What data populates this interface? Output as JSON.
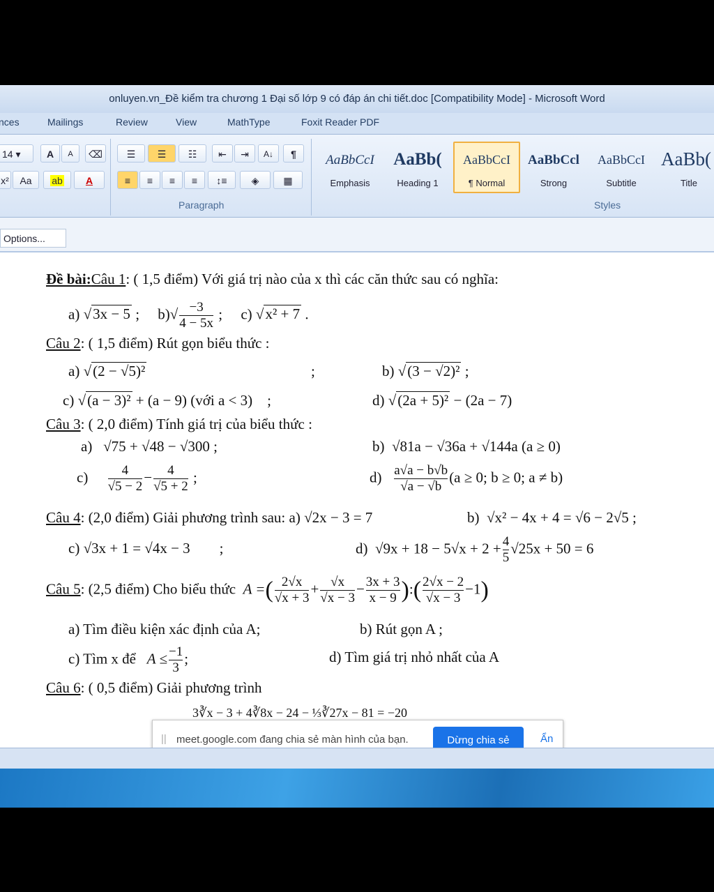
{
  "window": {
    "title": "onluyen.vn_Đề kiểm tra chương 1 Đại số lớp 9 có đáp án chi tiết.doc [Compatibility Mode] - Microsoft Word"
  },
  "ribbon": {
    "tabs": [
      "nces",
      "Mailings",
      "Review",
      "View",
      "MathType",
      "Foxit Reader PDF"
    ],
    "font_size": "14",
    "font_grow": "A",
    "font_shrink": "A",
    "change_case": "Aa",
    "font_color_glyph": "A",
    "pilcrow": "¶",
    "sort_glyph": "A↓",
    "paragraph_label": "Paragraph",
    "styles_label": "Styles",
    "styles": [
      {
        "preview": "AaBbCcI",
        "name": "Emphasis"
      },
      {
        "preview": "AaBb(",
        "name": "Heading 1"
      },
      {
        "preview": "AaBbCcI",
        "name": "¶ Normal"
      },
      {
        "preview": "AaBbCcl",
        "name": "Strong"
      },
      {
        "preview": "AaBbCcI",
        "name": "Subtitle"
      },
      {
        "preview": "AaBb(",
        "name": "Title"
      }
    ]
  },
  "options_button": "Options...",
  "document": {
    "l1_head": "Đề bài:",
    "l1_q": "Câu 1",
    "l1_text": ": ( 1,5 điểm) Với giá trị nào của x thì các căn thức sau có nghĩa:",
    "q1a": "3x − 5",
    "q1b_num": "−3",
    "q1b_den": "4 − 5x",
    "q1c": "x² + 7",
    "q2_q": "Câu 2",
    "q2_text": ": ( 1,5 điểm) Rút gọn biểu thức :",
    "q2a": "(2 − √5)²",
    "q2b": "(3 − √2)²",
    "q2c": "(a − 3)²",
    "q2c_tail": "+ (a − 9)  (với a < 3)",
    "q2d": "(2a + 5)²",
    "q2d_tail": "− (2a − 7)",
    "q3_q": "Câu 3",
    "q3_text": ": ( 2,0 điểm) Tính giá trị của biểu thức :",
    "q3a": "√75 + √48 − √300 ;",
    "q3b": "√81a − √36a + √144a (a ≥ 0)",
    "q3c_n1": "4",
    "q3c_d1": "√5 − 2",
    "q3c_n2": "4",
    "q3c_d2": "√5 + 2",
    "q3d_num": "a√a − b√b",
    "q3d_den": "√a − √b",
    "q3d_cond": "(a ≥ 0; b ≥ 0; a ≠ b)",
    "q4_q": "Câu 4",
    "q4_text": ": (2,0 điểm) Giải phương trình sau: a)",
    "q4a": "√2x − 3 = 7",
    "q4b": "√x² − 4x + 4 = √6 − 2√5 ;",
    "q4c": "√3x + 1 = √4x − 3",
    "q4d_pre": "√9x + 18 − 5√x + 2 +",
    "q4d_fn": "4",
    "q4d_fd": "5",
    "q4d_post": "√25x + 50 = 6",
    "q5_q": "Câu 5",
    "q5_text": ": (2,5 điểm) Cho biểu thức",
    "q5_A": "A =",
    "q5_t1n": "2√x",
    "q5_t1d": "√x + 3",
    "q5_t2n": "√x",
    "q5_t2d": "√x − 3",
    "q5_t3n": "3x + 3",
    "q5_t3d": "x − 9",
    "q5_t4n": "2√x − 2",
    "q5_t4d": "√x − 3",
    "q5a": "a)  Tìm điều kiện xác định của A;",
    "q5b": "b)  Rút gọn A ;",
    "q5c_pre": "c) Tìm x để",
    "q5c_A": "A ≤",
    "q5c_fn": "−1",
    "q5c_fd": "3",
    "q5d": "d) Tìm giá trị nhỏ nhất của A",
    "q6_q": "Câu 6",
    "q6_text": ": ( 0,5 điểm) Giải phương trình",
    "q6_eq": "3∛x − 3 + 4∛8x − 24 − ⅓∛27x − 81 = −20"
  },
  "share_notice": {
    "text": "meet.google.com đang chia sẻ màn hình của bạn.",
    "stop_button": "Dừng chia sẻ",
    "hide_button": "Ẩn"
  }
}
